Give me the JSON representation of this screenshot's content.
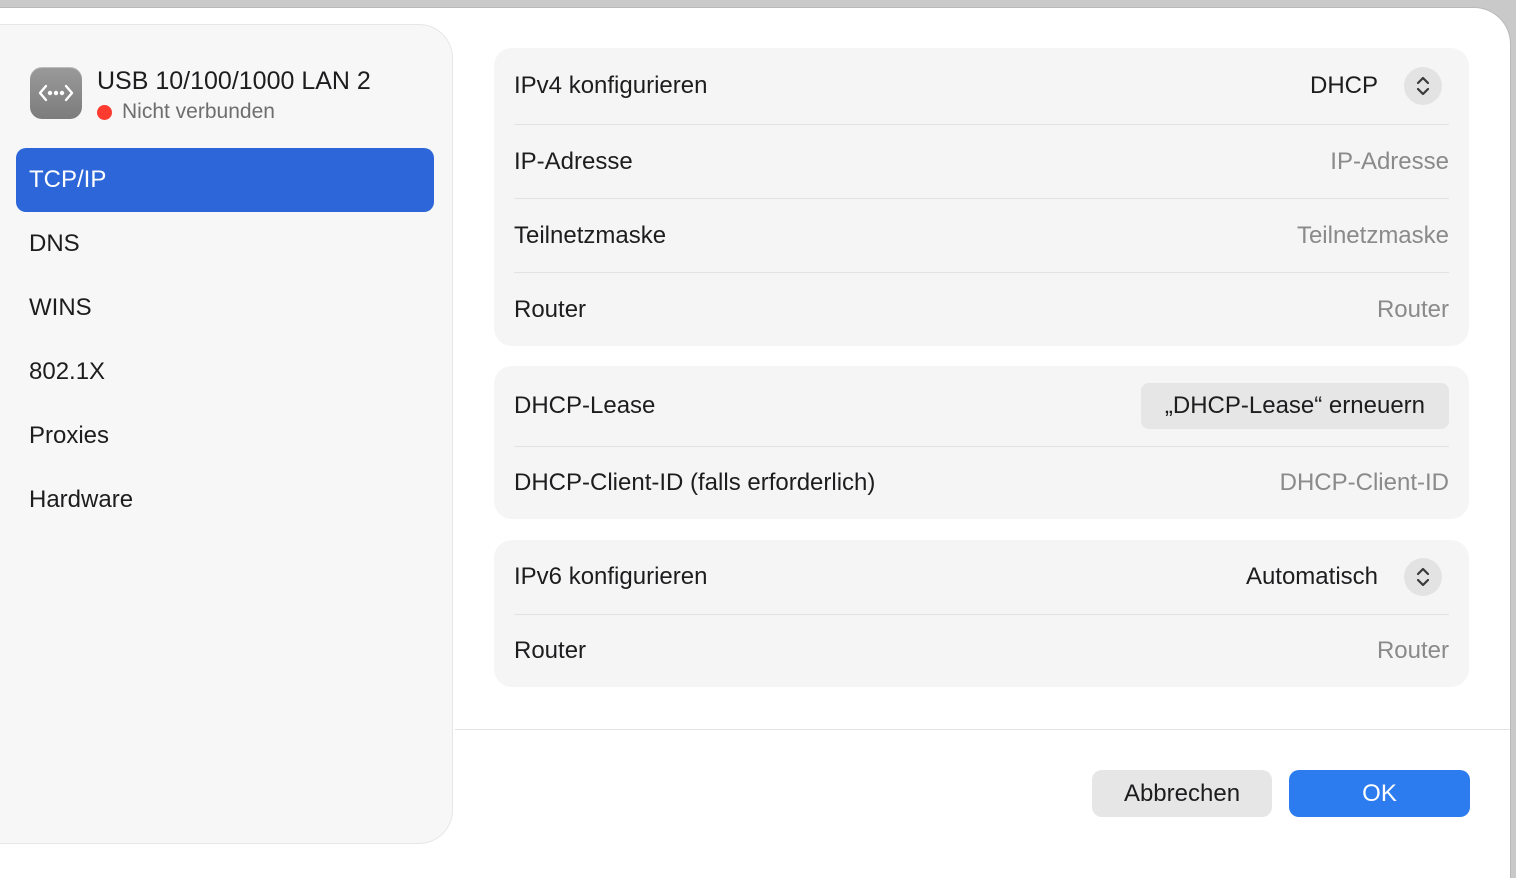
{
  "sidebar": {
    "device": {
      "name": "USB 10/100/1000 LAN 2",
      "status": "Nicht verbunden",
      "status_color": "#ff3b30",
      "icon": "ethernet-icon"
    },
    "items": [
      {
        "label": "TCP/IP",
        "selected": true
      },
      {
        "label": "DNS",
        "selected": false
      },
      {
        "label": "WINS",
        "selected": false
      },
      {
        "label": "802.1X",
        "selected": false
      },
      {
        "label": "Proxies",
        "selected": false
      },
      {
        "label": "Hardware",
        "selected": false
      }
    ],
    "accent_color": "#2c66d8"
  },
  "ipv4": {
    "configure_label": "IPv4 konfigurieren",
    "configure_value": "DHCP",
    "ip_label": "IP-Adresse",
    "ip_placeholder": "IP-Adresse",
    "subnet_label": "Teilnetzmaske",
    "subnet_placeholder": "Teilnetzmaske",
    "router_label": "Router",
    "router_placeholder": "Router"
  },
  "dhcp": {
    "lease_label": "DHCP-Lease",
    "renew_button": "„DHCP-Lease“ erneuern",
    "client_id_label": "DHCP-Client-ID (falls erforderlich)",
    "client_id_placeholder": "DHCP-Client-ID"
  },
  "ipv6": {
    "configure_label": "IPv6 konfigurieren",
    "configure_value": "Automatisch",
    "router_label": "Router",
    "router_placeholder": "Router"
  },
  "footer": {
    "cancel_label": "Abbrechen",
    "ok_label": "OK",
    "ok_color": "#2c7cf0"
  }
}
